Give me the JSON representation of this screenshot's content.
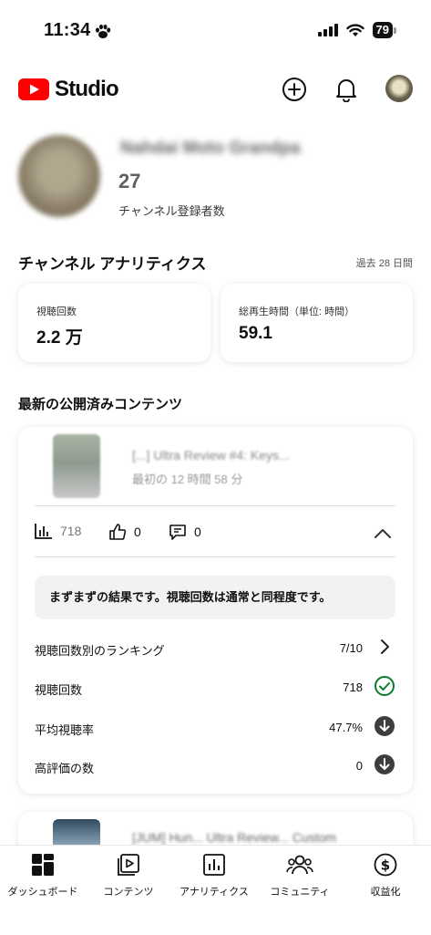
{
  "status_bar": {
    "time": "11:34",
    "battery": "79"
  },
  "header": {
    "brand": "Studio"
  },
  "channel": {
    "name": "Nahdai Moto Grandpa",
    "subscriber_count": "27",
    "subscriber_label": "チャンネル登録者数"
  },
  "analytics": {
    "title": "チャンネル アナリティクス",
    "period": "過去 28 日間",
    "cards": [
      {
        "label": "視聴回数",
        "value": "2.2 万"
      },
      {
        "label": "総再生時間（単位: 時間）",
        "value": "59.1"
      }
    ]
  },
  "latest": {
    "title": "最新の公開済みコンテンツ",
    "video": {
      "title": "[...] Ultra Review #4: Keys...",
      "time_label": "最初の 12 時間 58 分",
      "views": "718",
      "likes": "0",
      "comments": "0",
      "summary": "まずまずの結果です。視聴回数は通常と同程度です。",
      "rows": [
        {
          "label": "視聴回数別のランキング",
          "value": "7/10",
          "icon": "chevron-right-icon"
        },
        {
          "label": "視聴回数",
          "value": "718",
          "icon": "check-circle-icon"
        },
        {
          "label": "平均視聴率",
          "value": "47.7%",
          "icon": "down-arrow-circle-icon"
        },
        {
          "label": "高評価の数",
          "value": "0",
          "icon": "down-arrow-circle-icon"
        }
      ]
    },
    "next_video_title": "[JUM] Hun... Ultra Review... Custom"
  },
  "bottom_nav": [
    {
      "label": "ダッシュボード",
      "icon": "dashboard-icon"
    },
    {
      "label": "コンテンツ",
      "icon": "content-icon"
    },
    {
      "label": "アナリティクス",
      "icon": "analytics-icon"
    },
    {
      "label": "コミュニティ",
      "icon": "community-icon"
    },
    {
      "label": "収益化",
      "icon": "monetization-icon"
    }
  ],
  "colors": {
    "brand_red": "#ff0000",
    "positive": "#0a7d28",
    "neutral_dark": "#3d3d3d"
  }
}
